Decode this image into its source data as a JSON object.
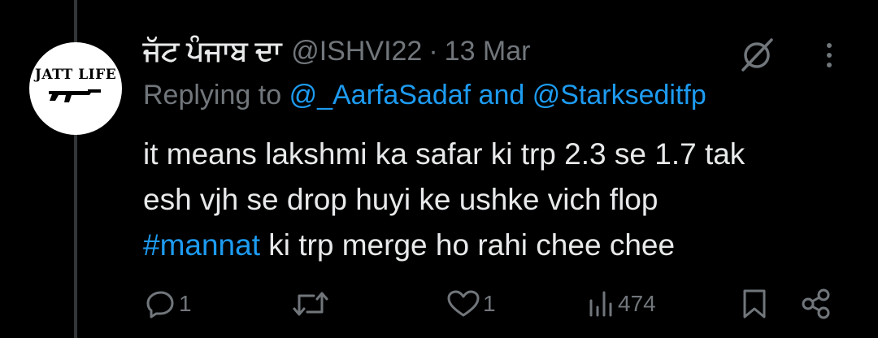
{
  "tweet": {
    "author": {
      "display_name": "ਜੱਟ ਪੰਜਾਬ ਦਾ",
      "handle": "@ISHVI22",
      "avatar_text": "JATT LIFE"
    },
    "separator": "·",
    "date": "13 Mar",
    "replying": {
      "prefix": "Replying to",
      "mentions": "@_AarfaSadaf and @Starkseditfp"
    },
    "text": {
      "line1": "it means lakshmi ka safar ki trp 2.3 se 1.7 tak",
      "line2": "esh vjh se drop huyi ke ushke vich flop",
      "hashtag": "#mannat",
      "line3_rest": " ki trp merge ho rahi chee chee"
    },
    "actions": {
      "reply_count": "1",
      "retweet_count": "",
      "like_count": "1",
      "views_count": "474"
    }
  },
  "icons": {
    "grok": "grok-icon",
    "more": "more-vertical-icon",
    "reply": "reply-icon",
    "retweet": "retweet-icon",
    "like": "heart-icon",
    "views": "views-icon",
    "bookmark": "bookmark-icon",
    "share": "share-icon"
  },
  "colors": {
    "background": "#000000",
    "text": "#e7e9ea",
    "muted": "#71767b",
    "accent": "#1d9bf0",
    "thread_line": "#333639"
  }
}
